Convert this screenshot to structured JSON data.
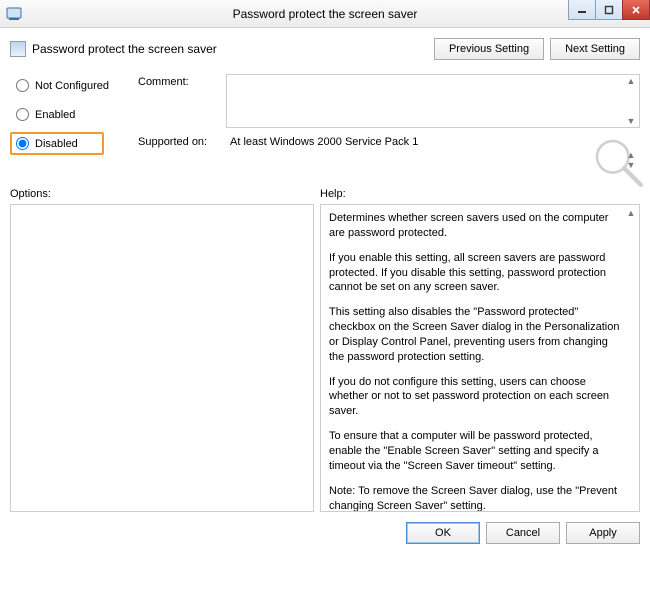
{
  "window": {
    "title": "Password protect the screen saver"
  },
  "header": {
    "title": "Password protect the screen saver"
  },
  "nav": {
    "previous": "Previous Setting",
    "next": "Next Setting"
  },
  "state": {
    "radios": {
      "not_configured": "Not Configured",
      "enabled": "Enabled",
      "disabled": "Disabled",
      "selected": "disabled"
    },
    "comment_label": "Comment:",
    "comment_value": "",
    "supported_label": "Supported on:",
    "supported_value": "At least Windows 2000 Service Pack 1"
  },
  "lower": {
    "options_label": "Options:",
    "help_label": "Help:",
    "help_paragraphs": [
      "Determines whether screen savers used on the computer are password protected.",
      "If you enable this setting, all screen savers are password protected. If you disable this setting, password protection cannot be set on any screen saver.",
      "This setting also disables the \"Password protected\" checkbox on the Screen Saver dialog in the Personalization or Display Control Panel, preventing users from changing the password protection setting.",
      "If you do not configure this setting, users can choose whether or not to set password protection on each screen saver.",
      "To ensure that a computer will be password protected, enable the \"Enable Screen Saver\" setting and specify a timeout via the \"Screen Saver timeout\" setting.",
      "Note: To remove the Screen Saver dialog, use the \"Prevent changing Screen Saver\" setting."
    ]
  },
  "footer": {
    "ok": "OK",
    "cancel": "Cancel",
    "apply": "Apply"
  }
}
